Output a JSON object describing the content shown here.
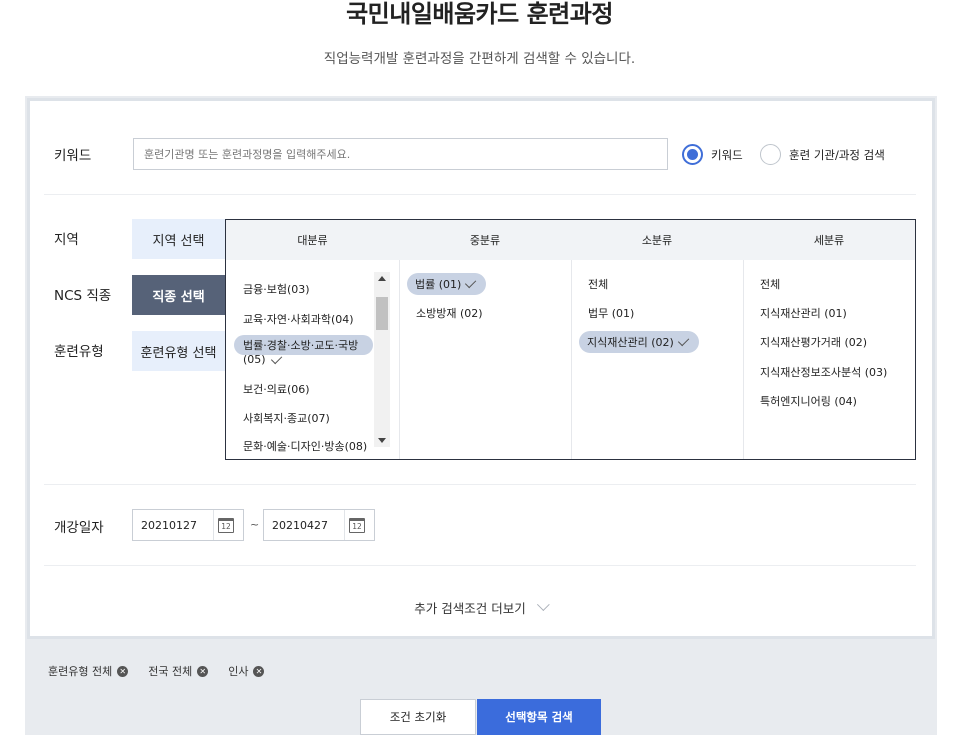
{
  "header": {
    "title": "국민내일배움카드 훈련과정",
    "subtitle": "직업능력개발 훈련과정을 간편하게 검색할 수 있습니다."
  },
  "keyword": {
    "label": "키워드",
    "placeholder": "훈련기관명 또는 훈련과정명을 입력해주세요.",
    "value": "",
    "radio_options": [
      {
        "label": "키워드",
        "selected": true
      },
      {
        "label": "훈련 기관/과정 검색",
        "selected": false
      }
    ]
  },
  "filters": {
    "region": {
      "label": "지역",
      "button": "지역 선택"
    },
    "ncs": {
      "label": "NCS 직종",
      "button": "직종 선택"
    },
    "training_type": {
      "label": "훈련유형",
      "button": "훈련유형 선택"
    }
  },
  "category_panel": {
    "headers": [
      "대분류",
      "중분류",
      "소분류",
      "세분류"
    ],
    "major": [
      {
        "label": "금융·보험(03)",
        "selected": false
      },
      {
        "label": "교육·자연·사회과학(04)",
        "selected": false
      },
      {
        "label_line1": "법률·경찰·소방·교도·국방",
        "label_line2": "(05)",
        "selected": true
      },
      {
        "label": "보건·의료(06)",
        "selected": false
      },
      {
        "label": "사회복지·종교(07)",
        "selected": false
      },
      {
        "label": "문화·예술·디자인·방송(08)",
        "selected": false
      }
    ],
    "middle": [
      {
        "label": "법률 (01)",
        "selected": true
      },
      {
        "label": "소방방재 (02)",
        "selected": false
      }
    ],
    "minor": [
      {
        "label": "전체",
        "selected": false
      },
      {
        "label": "법무 (01)",
        "selected": false
      },
      {
        "label": "지식재산관리 (02)",
        "selected": true
      }
    ],
    "detail": [
      {
        "label": "전체"
      },
      {
        "label": "지식재산관리 (01)"
      },
      {
        "label": "지식재산평가거래 (02)"
      },
      {
        "label": "지식재산정보조사분석 (03)"
      },
      {
        "label": "특허엔지니어링 (04)"
      }
    ]
  },
  "dates": {
    "label": "개강일자",
    "start": "20210127",
    "end": "20210427",
    "separator": "~",
    "calendar_icon_text": "12"
  },
  "more_options": {
    "label": "추가 검색조건 더보기"
  },
  "selected_chips": [
    {
      "label": "훈련유형 전체"
    },
    {
      "label": "전국 전체"
    },
    {
      "label": "인사"
    }
  ],
  "actions": {
    "reset": "조건 초기화",
    "search": "선택항목 검색"
  },
  "colors": {
    "accent": "#3b6cdc",
    "dark_button": "#566278",
    "light_button": "#e7effb",
    "selected_pill": "#c8d2e3"
  }
}
